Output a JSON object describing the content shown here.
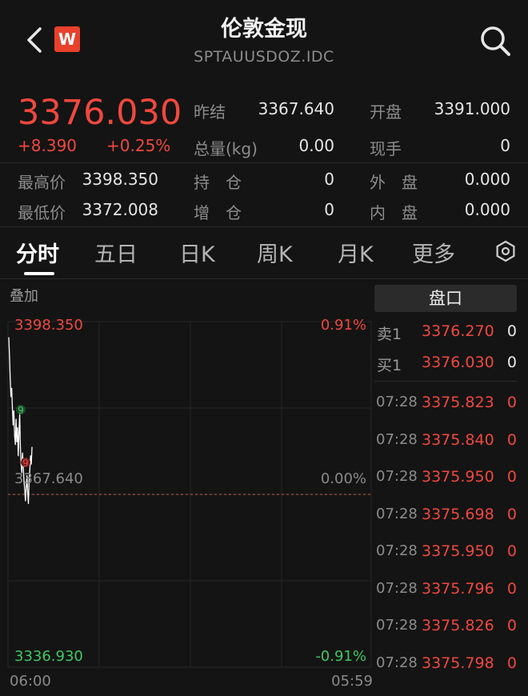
{
  "header": {
    "title": "伦敦金现",
    "subtitle": "SPTAUUSDOZ.IDC",
    "logo_text": "W"
  },
  "quote": {
    "price": "3376.030",
    "change": "+8.390",
    "change_pct": "+0.25%",
    "stats": [
      {
        "label": "昨结",
        "value": "3367.640"
      },
      {
        "label": "开盘",
        "value": "3391.000"
      },
      {
        "label": "总量(kg)",
        "value": "0.00"
      },
      {
        "label": "现手",
        "value": "0"
      },
      {
        "label": "最高价",
        "value": "3398.350"
      },
      {
        "label": "持　仓",
        "value": "0"
      },
      {
        "label": "外　盘",
        "value": "0.000"
      },
      {
        "label": "最低价",
        "value": "3372.008"
      },
      {
        "label": "增　仓",
        "value": "0"
      },
      {
        "label": "内　盘",
        "value": "0.000"
      }
    ]
  },
  "tabs": [
    "分时",
    "五日",
    "日K",
    "周K",
    "月K",
    "更多"
  ],
  "active_tab": "分时",
  "chart": {
    "overlay_label": "叠加",
    "y_high": "3398.350",
    "y_mid": "3367.640",
    "y_low": "3336.930",
    "pct_high": "0.91%",
    "pct_mid": "0.00%",
    "pct_low": "-0.91%",
    "x_start": "06:00",
    "x_end": "05:59",
    "marker_low": "9",
    "marker_high": "9"
  },
  "chart_data": {
    "type": "line",
    "ylim": [
      3336.93,
      3398.35
    ],
    "reference": 3367.64,
    "x_labels": [
      "06:00",
      "05:59"
    ],
    "series": [
      {
        "values": [
          3395.5,
          3392.0,
          3388.0,
          3385.0,
          3386.5,
          3383.0,
          3380.0,
          3382.5,
          3378.0,
          3376.5,
          3381.0,
          3377.0,
          3379.5,
          3374.5,
          3378.5,
          3382.0,
          3376.0,
          3373.0,
          3371.5,
          3375.0,
          3372.5,
          3370.0,
          3368.5,
          3366.5,
          3369.0,
          3371.0,
          3368.0,
          3366.0,
          3370.0,
          3372.0,
          3374.5,
          3373.0,
          3376.03
        ]
      }
    ],
    "colors": {
      "line": "#ffffff",
      "ref": "#c0603a",
      "grid": "#262626",
      "up": "#f0483e",
      "down": "#3ec864"
    }
  },
  "orderbook": {
    "panel_title": "盘口",
    "ask": {
      "label": "卖1",
      "price": "3376.270",
      "volume": "0"
    },
    "bid": {
      "label": "买1",
      "price": "3376.030",
      "volume": "0"
    },
    "ticks": [
      {
        "time": "07:28",
        "price": "3375.823",
        "volume": "0"
      },
      {
        "time": "07:28",
        "price": "3375.840",
        "volume": "0"
      },
      {
        "time": "07:28",
        "price": "3375.950",
        "volume": "0"
      },
      {
        "time": "07:28",
        "price": "3375.698",
        "volume": "0"
      },
      {
        "time": "07:28",
        "price": "3375.950",
        "volume": "0"
      },
      {
        "time": "07:28",
        "price": "3375.796",
        "volume": "0"
      },
      {
        "time": "07:28",
        "price": "3375.826",
        "volume": "0"
      },
      {
        "time": "07:28",
        "price": "3375.798",
        "volume": "0"
      }
    ]
  }
}
